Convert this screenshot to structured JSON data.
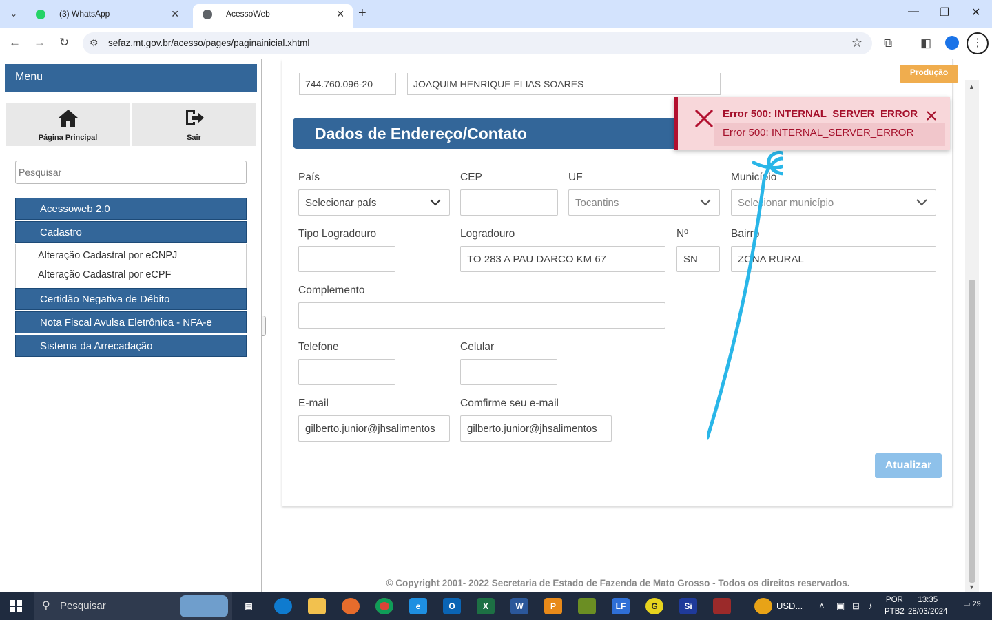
{
  "browser": {
    "tabs": [
      {
        "label": "(3) WhatsApp",
        "active": false,
        "favicon": "whatsapp-icon"
      },
      {
        "label": "AcessoWeb",
        "active": true,
        "favicon": "globe-icon"
      }
    ],
    "url": "sefaz.mt.gov.br/acesso/pages/paginainicial.xhtml"
  },
  "sidebar": {
    "title": "Menu",
    "quick": [
      {
        "label": "Página Principal",
        "icon": "home-icon"
      },
      {
        "label": "Sair",
        "icon": "logout-icon"
      }
    ],
    "search_placeholder": "Pesquisar",
    "items": [
      {
        "label": "Acessoweb 2.0"
      },
      {
        "label": "Cadastro"
      },
      {
        "label": "Certidão Negativa de Débito"
      },
      {
        "label": "Nota Fiscal Avulsa Eletrônica - NFA-e"
      },
      {
        "label": "Sistema da Arrecadação"
      }
    ],
    "cadastro_sub": [
      {
        "label": "Alteração Cadastral por eCNPJ"
      },
      {
        "label": "Alteração Cadastral por eCPF"
      }
    ]
  },
  "env_badge": "Produção",
  "top_fields": {
    "cpf": "744.760.096-20",
    "name": "JOAQUIM HENRIQUE ELIAS SOARES"
  },
  "section_title": "Dados de Endereço/Contato",
  "form": {
    "pais": {
      "label": "País",
      "value": "Selecionar país"
    },
    "cep": {
      "label": "CEP",
      "value": ""
    },
    "uf": {
      "label": "UF",
      "value": "Tocantins"
    },
    "municipio": {
      "label": "Município",
      "value": "Selecionar município"
    },
    "tipo_logradouro": {
      "label": "Tipo Logradouro",
      "value": ""
    },
    "logradouro": {
      "label": "Logradouro",
      "value": "TO 283 A PAU DARCO KM 67"
    },
    "numero": {
      "label": "Nº",
      "value": "SN"
    },
    "bairro": {
      "label": "Bairro",
      "value": "ZONA RURAL"
    },
    "complemento": {
      "label": "Complemento",
      "value": ""
    },
    "telefone": {
      "label": "Telefone",
      "value": ""
    },
    "celular": {
      "label": "Celular",
      "value": ""
    },
    "email": {
      "label": "E-mail",
      "value": "gilberto.junior@jhsalimentos"
    },
    "email_confirm": {
      "label": "Comfirme seu e-mail",
      "value": "gilberto.junior@jhsalimentos"
    },
    "submit": "Atualizar"
  },
  "toast": {
    "title": "Error 500: INTERNAL_SERVER_ERROR",
    "detail": "Error 500: INTERNAL_SERVER_ERROR",
    "color": "#a5102b"
  },
  "copyright": "© Copyright 2001- 2022 Secretaria de Estado de Fazenda de Mato Grosso - Todos os direitos reservados.",
  "taskbar": {
    "search": "Pesquisar",
    "tray_text": "USD...",
    "lang": [
      "POR",
      "PTB2"
    ],
    "time": "13:35",
    "date": "28/03/2024",
    "notifications": "29"
  },
  "colors": {
    "primary": "#336699",
    "badge": "#f0ad4e",
    "button": "#8ec1ea"
  }
}
